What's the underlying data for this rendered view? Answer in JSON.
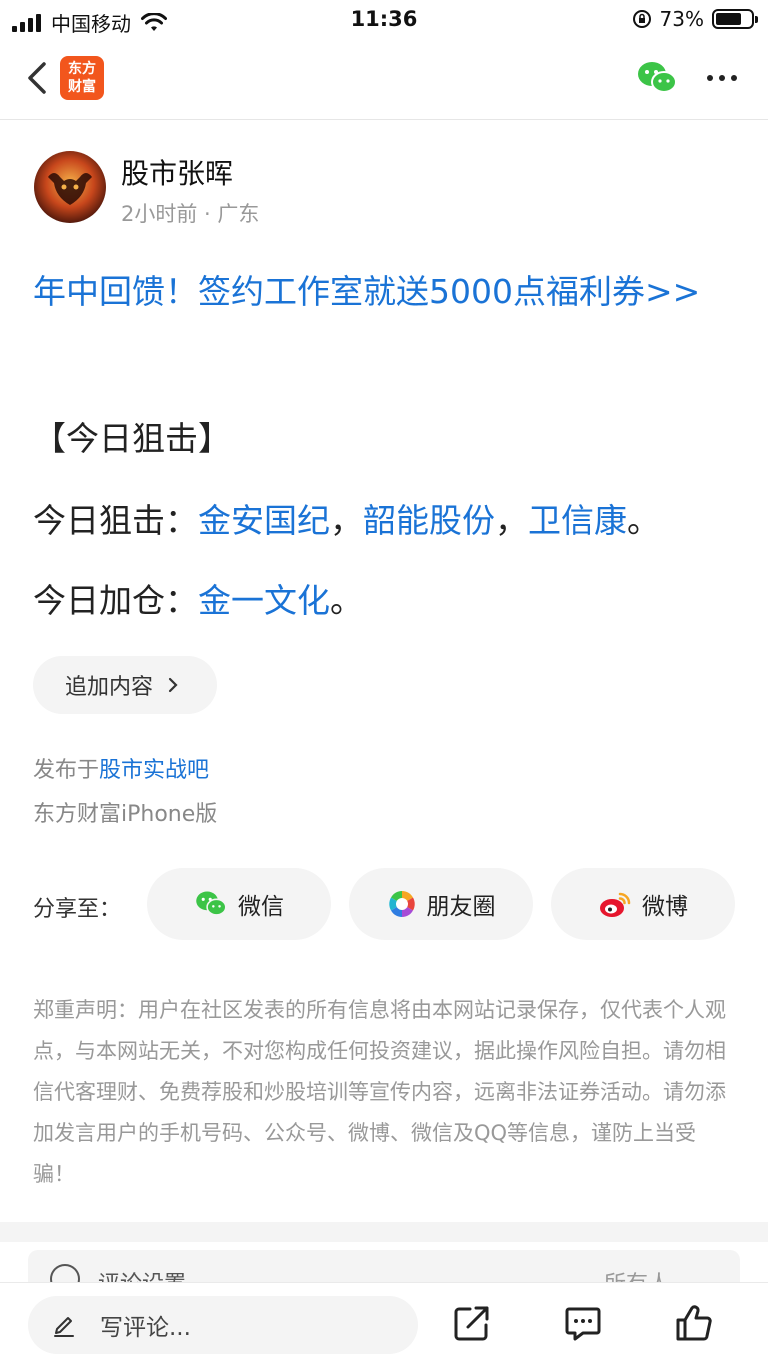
{
  "status_bar": {
    "carrier": "中国移动",
    "time": "11:36",
    "battery": "73%",
    "battery_level": 0.73
  },
  "nav": {
    "logo_line1": "东方",
    "logo_line2": "财富"
  },
  "author": {
    "name": "股市张晖",
    "meta": "2小时前 · 广东"
  },
  "post": {
    "promo_link": "年中回馈！签约工作室就送5000点福利券>>",
    "heading": "【今日狙击】",
    "line1": {
      "label": "今日狙击：",
      "stocks": [
        "金安国纪",
        "韶能股份",
        "卫信康"
      ],
      "sep": "，",
      "end": "。"
    },
    "line2": {
      "label": "今日加仓：",
      "stocks": [
        "金一文化"
      ],
      "end": "。"
    },
    "append_label": "追加内容",
    "publish_prefix": "发布于",
    "forum": "股市实战吧",
    "device": "东方财富iPhone版"
  },
  "share": {
    "label": "分享至：",
    "wechat": "微信",
    "moments": "朋友圈",
    "weibo": "微博"
  },
  "disclaimer": "郑重声明：用户在社区发表的所有信息将由本网站记录保存，仅代表个人观点，与本网站无关，不对您构成任何投资建议，据此操作风险自担。请勿相信代客理财、免费荐股和炒股培训等宣传内容，远离非法证券活动。请勿添加发言用户的手机号码、公众号、微博、微信及QQ等信息，谨防上当受骗！",
  "comment_settings": {
    "label": "评论设置",
    "value": "所有人"
  },
  "bottom_bar": {
    "comment_placeholder": "写评论..."
  }
}
